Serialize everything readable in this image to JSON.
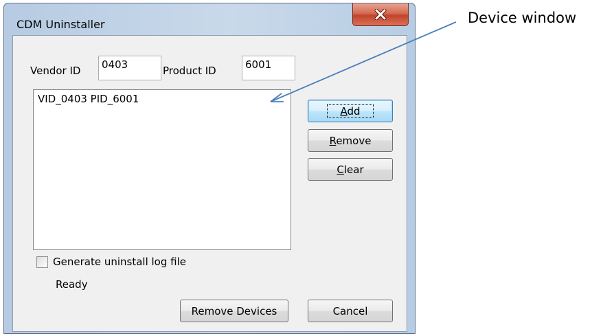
{
  "window": {
    "title": "CDM Uninstaller"
  },
  "fields": {
    "vendor_id_label": "Vendor ID",
    "vendor_id_value": "0403",
    "product_id_label": "Product ID",
    "product_id_value": "6001"
  },
  "device_list": {
    "items": [
      "VID_0403 PID_6001"
    ]
  },
  "buttons": {
    "add": {
      "prefix": "",
      "accel": "A",
      "suffix": "dd"
    },
    "remove": {
      "prefix": "",
      "accel": "R",
      "suffix": "emove"
    },
    "clear": {
      "prefix": "",
      "accel": "C",
      "suffix": "lear"
    },
    "remove_devices": "Remove Devices",
    "cancel": "Cancel"
  },
  "log_option": {
    "label": "Generate uninstall log file",
    "checked": false
  },
  "status": {
    "text": "Ready"
  },
  "annotation": {
    "text": "Device window",
    "arrow_color": "#4a7ebb"
  },
  "icons": {
    "close": "close-icon"
  }
}
